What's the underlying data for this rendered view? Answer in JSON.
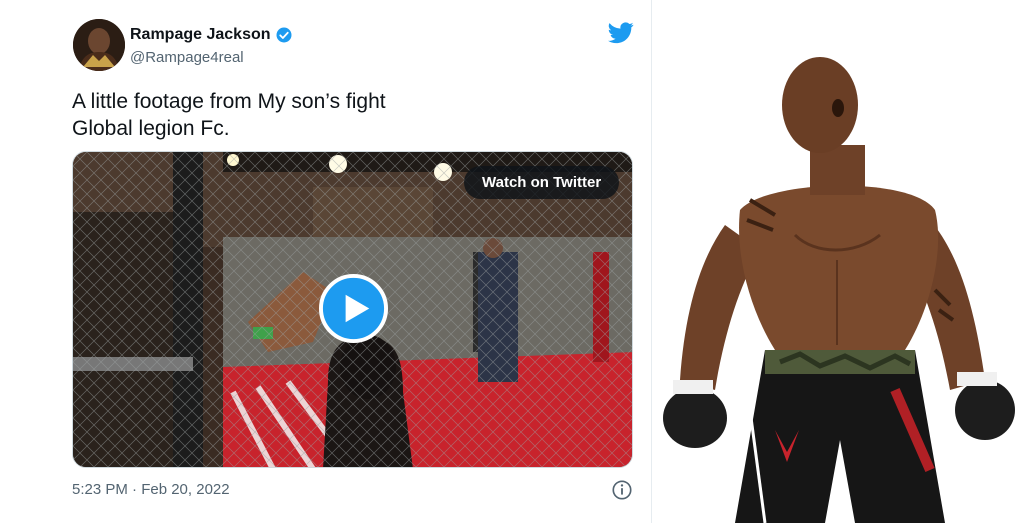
{
  "tweet": {
    "display_name": "Rampage Jackson",
    "handle": "@Rampage4real",
    "text_lines": [
      "A little footage from My son’s fight",
      "Global legion Fc."
    ],
    "watch_label": "Watch on Twitter",
    "timestamp": "5:23 PM · Feb 20, 2022"
  },
  "colors": {
    "twitter_blue": "#1d9bf0",
    "text_primary": "#0f1419",
    "text_secondary": "#536471",
    "octagon_mat_red": "#c8232c"
  },
  "icons": {
    "verified": "verified-badge-icon",
    "brand": "twitter-bird-icon",
    "play": "play-icon",
    "info": "info-icon"
  }
}
